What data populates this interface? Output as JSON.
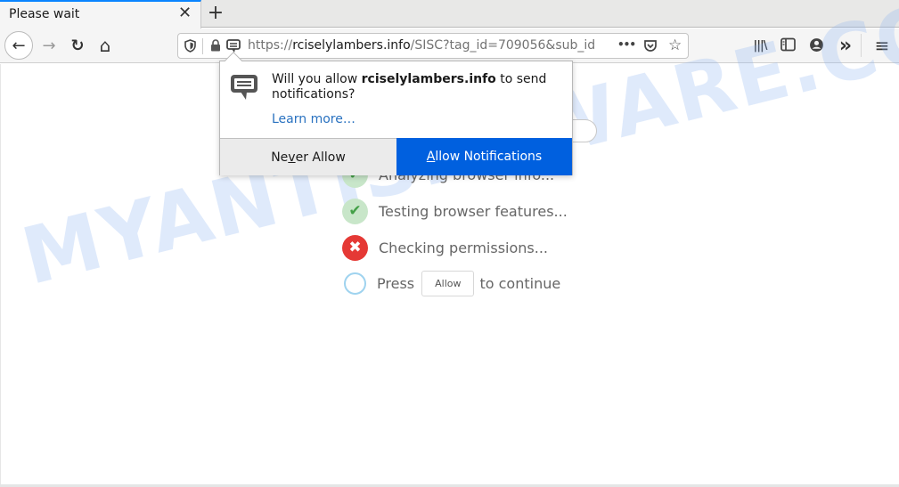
{
  "tab": {
    "title": "Please wait",
    "close_glyph": "✕",
    "new_tab_glyph": "+"
  },
  "nav": {
    "back_glyph": "←",
    "forward_glyph": "→",
    "reload_glyph": "↻",
    "home_glyph": "⌂",
    "url_scheme": "https://",
    "url_host": "rciselylambers.info",
    "url_rest": "/SISC?tag_id=709056&sub_id",
    "page_actions_glyph": "•••",
    "pocket_glyph": "♡",
    "star_glyph": "☆",
    "library_glyph": "|||\\",
    "sidebar_glyph": "▯",
    "account_glyph": "●",
    "overflow_glyph": "»",
    "menu_glyph": "≡"
  },
  "popup": {
    "msg_before": "Will you allow ",
    "msg_host": "rciselylambers.info",
    "msg_after": " to send notifications?",
    "learn_more": "Learn more…",
    "never_pre": "Ne",
    "never_u": "v",
    "never_post": "er Allow",
    "allow_u": "A",
    "allow_post": "llow Notifications",
    "accent": "#0060df"
  },
  "steps": [
    {
      "status": "ok",
      "glyph": "✔",
      "text": "Analyzing browser info..."
    },
    {
      "status": "ok",
      "glyph": "✔",
      "text": "Testing browser features..."
    },
    {
      "status": "fail",
      "glyph": "✖",
      "text": "Checking permissions..."
    },
    {
      "status": "pending",
      "glyph": "",
      "text_before": "Press",
      "button": "Allow",
      "text_after": "to continue"
    }
  ],
  "watermark": "MYANTISPYWARE.COM"
}
